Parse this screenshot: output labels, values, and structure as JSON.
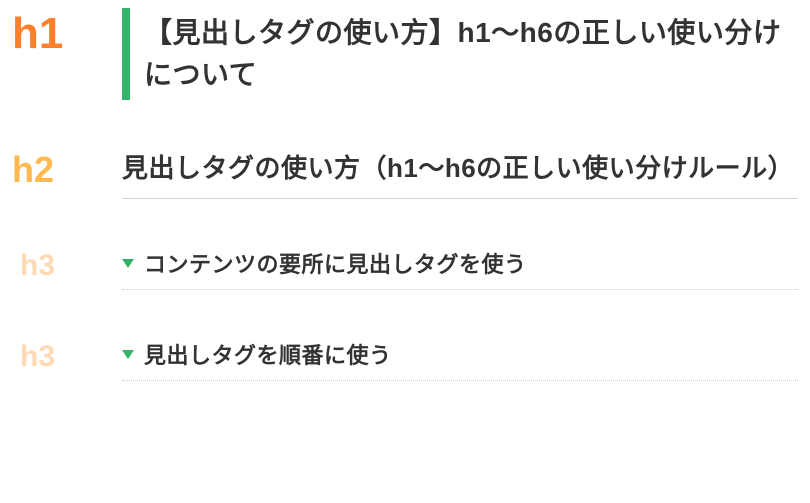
{
  "items": [
    {
      "level": "h1",
      "text": "【見出しタグの使い方】h1～h6の正しい使い分けについて"
    },
    {
      "level": "h2",
      "text": "見出しタグの使い方（h1～h6の正しい使い分けルール）"
    },
    {
      "level": "h3",
      "text": "コンテンツの要所に見出しタグを使う"
    },
    {
      "level": "h3",
      "text": "見出しタグを順番に使う"
    }
  ]
}
